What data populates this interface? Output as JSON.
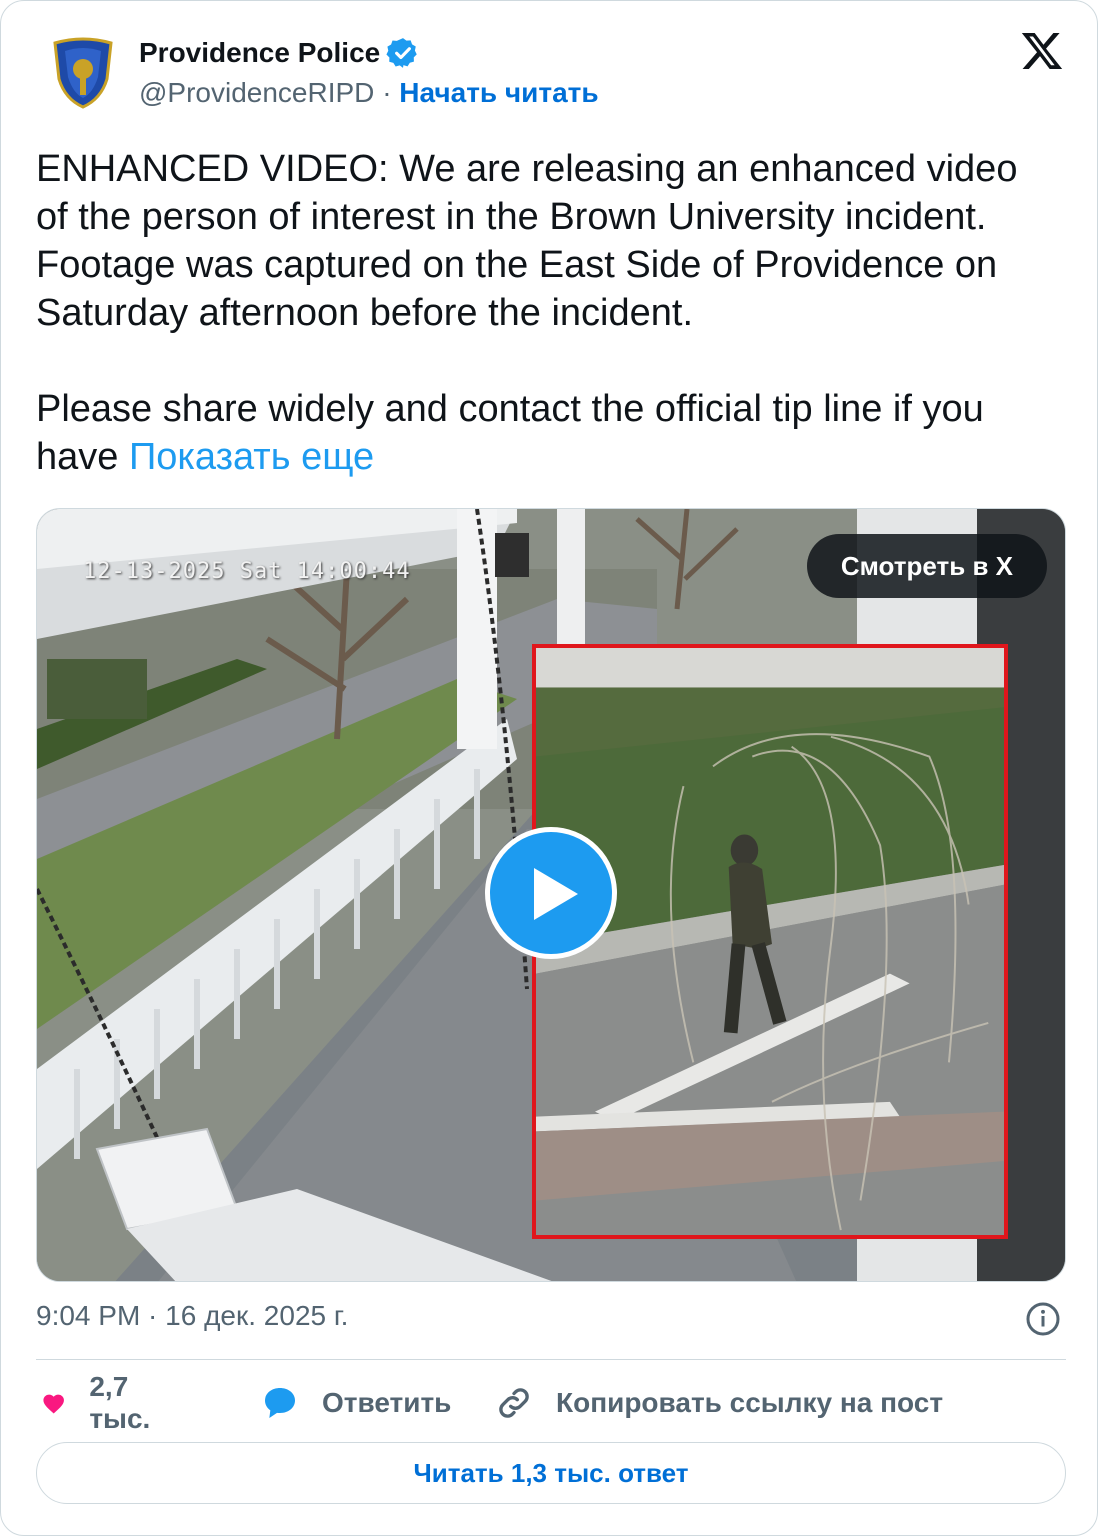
{
  "author": {
    "name": "Providence Police",
    "handle": "@ProvidenceRIPD",
    "separator": "·",
    "follow_label": "Начать читать",
    "verified": true
  },
  "tweet": {
    "paragraph1": "ENHANCED VIDEO: We are releasing an enhanced video of the person of interest in the Brown University incident. Footage was captured on the East Side of Providence on Saturday afternoon before the incident.",
    "paragraph2": "Please share widely and contact the official tip line if you have ",
    "show_more": "Показать еще"
  },
  "media": {
    "camera_timestamp": "12-13-2025 Sat 14:00:44",
    "watch_label": "Смотреть в X",
    "inset_border_color": "#e0161c"
  },
  "meta": {
    "timestamp": "9:04 PM · 16 дек. 2025 г."
  },
  "actions": {
    "likes": "2,7 тыс.",
    "reply_label": "Ответить",
    "copy_link_label": "Копировать ссылку на пост"
  },
  "read_replies_label": "Читать 1,3 тыс. ответ",
  "colors": {
    "accent": "#1d9bf0",
    "link": "#006fd6",
    "like": "#f91880",
    "secondary_text": "#536471"
  }
}
